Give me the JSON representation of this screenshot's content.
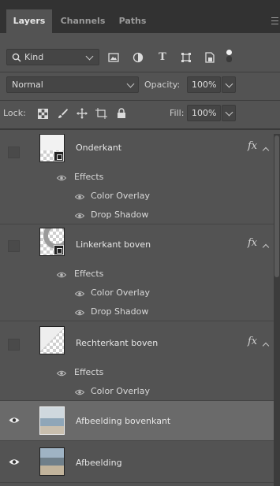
{
  "tabs": [
    {
      "label": "Layers",
      "active": true
    },
    {
      "label": "Channels",
      "active": false
    },
    {
      "label": "Paths",
      "active": false
    }
  ],
  "filter": {
    "kind_label": "Kind",
    "icons": [
      "image-filter-icon",
      "adjustment-filter-icon",
      "type-filter-icon",
      "shape-filter-icon",
      "smart-object-filter-icon",
      "filter-toggle-icon"
    ]
  },
  "blend": {
    "mode": "Normal",
    "opacity_label": "Opacity:",
    "opacity_value": "100%"
  },
  "lock": {
    "label": "Lock:",
    "icons": [
      "lock-transparent-pixels-icon",
      "lock-image-pixels-icon",
      "lock-position-icon",
      "lock-artboard-icon",
      "lock-all-icon"
    ],
    "fill_label": "Fill:",
    "fill_value": "100%"
  },
  "layers": [
    {
      "name": "Onderkant",
      "visible": false,
      "fx": "fx",
      "effects_label": "Effects",
      "effects": [
        "Color Overlay",
        "Drop Shadow"
      ]
    },
    {
      "name": "Linkerkant boven",
      "visible": false,
      "fx": "fx",
      "effects_label": "Effects",
      "effects": [
        "Color Overlay",
        "Drop Shadow"
      ]
    },
    {
      "name": "Rechterkant boven",
      "visible": false,
      "fx": "fx",
      "effects_label": "Effects",
      "effects": [
        "Color Overlay"
      ]
    },
    {
      "name": "Afbeelding bovenkant",
      "visible": true,
      "selected": true
    },
    {
      "name": "Afbeelding",
      "visible": true
    }
  ],
  "colors": {
    "panel": "#535353",
    "tabbar": "#323232",
    "selected": "#6a6a6a",
    "text": "#e6e6e6"
  }
}
